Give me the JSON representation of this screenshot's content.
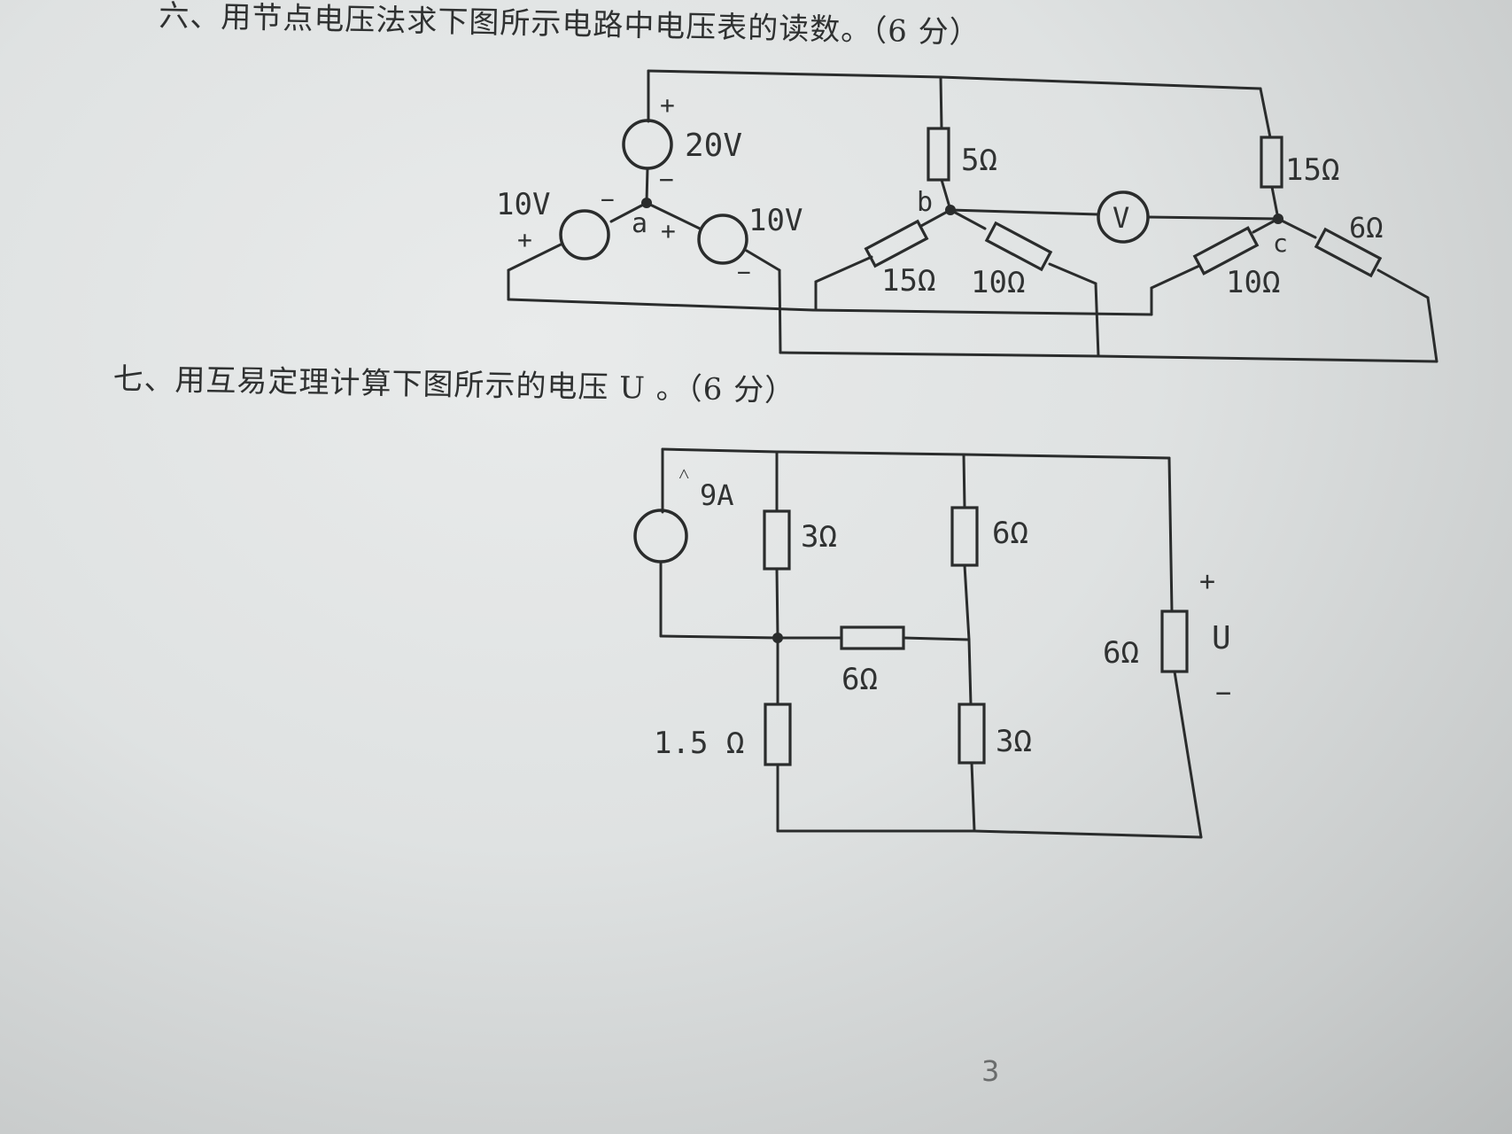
{
  "question6": {
    "text": "六、用节点电压法求下图所示电路中电压表的读数。（6 分）",
    "labels": {
      "src_top_value": "20V",
      "src_top_plus": "+",
      "src_top_minus": "−",
      "src_left_value": "10V",
      "src_left_plus": "+",
      "src_left_minus": "−",
      "src_right_value": "10V",
      "src_right_plus": "+",
      "src_right_minus": "−",
      "node_a": "a",
      "node_b": "b",
      "node_c": "c",
      "r_5": "5Ω",
      "r_15_top": "15Ω",
      "r_15_b": "15Ω",
      "r_10_b": "10Ω",
      "r_10_c": "10Ω",
      "r_6": "6Ω",
      "voltmeter": "V"
    }
  },
  "question7": {
    "text": "七、用互易定理计算下图所示的电压 U 。（6 分）",
    "labels": {
      "current_source": "9A",
      "r_3_top": "3Ω",
      "r_6_top": "6Ω",
      "r_6_mid": "6Ω",
      "r_1_5": "1.5 Ω",
      "r_3_bottom": "3Ω",
      "r_6_right": "6Ω",
      "u_plus": "+",
      "u_label": "U",
      "u_minus": "−"
    }
  },
  "page_number": "3"
}
